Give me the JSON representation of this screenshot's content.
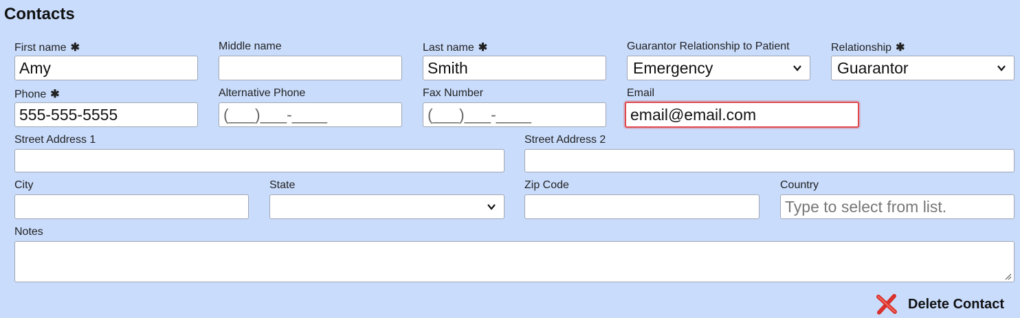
{
  "section": {
    "title": "Contacts"
  },
  "fields": {
    "first_name": {
      "label": "First name",
      "required": "✱",
      "value": "Amy"
    },
    "middle_name": {
      "label": "Middle name",
      "value": ""
    },
    "last_name": {
      "label": "Last name",
      "required": "✱",
      "value": "Smith"
    },
    "guarantor_relationship": {
      "label": "Guarantor Relationship to Patient",
      "value": "Emergency"
    },
    "relationship": {
      "label": "Relationship",
      "required": "✱",
      "value": "Guarantor"
    },
    "phone": {
      "label": "Phone",
      "required": "✱",
      "value": "555-555-5555"
    },
    "alt_phone": {
      "label": "Alternative Phone",
      "value": "(___)___-____"
    },
    "fax": {
      "label": "Fax Number",
      "value": "(___)___-____"
    },
    "email": {
      "label": "Email",
      "value": "email@email.com"
    },
    "street1": {
      "label": "Street Address 1",
      "value": ""
    },
    "street2": {
      "label": "Street Address 2",
      "value": ""
    },
    "city": {
      "label": "City",
      "value": ""
    },
    "state": {
      "label": "State",
      "value": ""
    },
    "zip": {
      "label": "Zip Code",
      "value": ""
    },
    "country": {
      "label": "Country",
      "placeholder": "Type to select from list."
    },
    "notes": {
      "label": "Notes",
      "value": ""
    }
  },
  "actions": {
    "delete_label": "Delete Contact"
  },
  "colors": {
    "background": "#c9dcfc",
    "focus_border": "#e0474c",
    "delete_icon": "#d9302c"
  }
}
